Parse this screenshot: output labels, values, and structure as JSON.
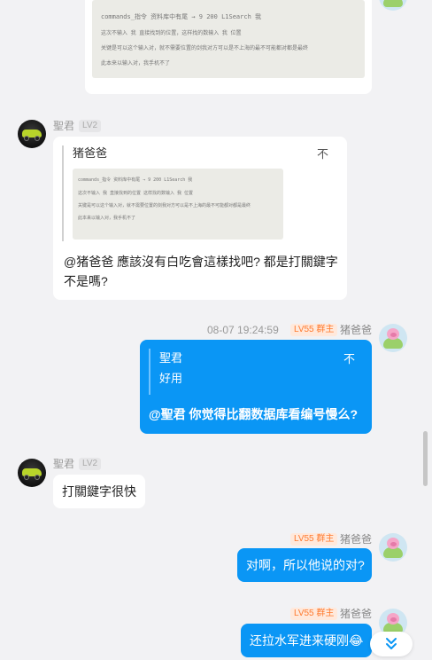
{
  "messages": {
    "top_image": {
      "line1": "commands_指令  资料库中有尾 → 9     200    L1Search    我",
      "line2": "这次不输入 我 直接找到的位置，这样找的数输入 我 位置",
      "line3": "关键是可以这个输入对，就不需要位置的剑我对方可以是不上海的最不可能都对都是最终",
      "line4": "此本来以输入对，我手机不了"
    },
    "msg2": {
      "name": "聖君",
      "level": "LV2",
      "quote_name": "猪爸爸",
      "quote_close": "不",
      "text": "@猪爸爸 應該沒有白吃會這樣找吧? 都是打關鍵字不是嗎?",
      "thumb_line1": "commands_指令  资料库中有尾 → 9    200    L1Search    我",
      "thumb_line2": "这次不输入 我 直接找到的位置 这样找的数输入 我 位置",
      "thumb_line3": "关键是可以这个输入对，就不需要位置的剑我对方可以是不上海的最不可能都对都是最终",
      "thumb_line4": "此本来以输入对，我手机不了"
    },
    "msg3": {
      "time": "08-07 19:24:59",
      "level": "LV55 群主",
      "name": "猪爸爸",
      "quote_name": "聖君",
      "quote_text": "好用",
      "quote_close": "不",
      "text": "@聖君 你觉得比翻数据库看编号慢么?"
    },
    "msg4": {
      "name": "聖君",
      "level": "LV2",
      "text": "打關鍵字很快"
    },
    "msg5": {
      "level": "LV55 群主",
      "name": "猪爸爸",
      "text": "对啊，所以他说的对?"
    },
    "msg6": {
      "level": "LV55 群主",
      "name": "猪爸爸",
      "text": "还拉水军进来硬刚😂"
    }
  },
  "icons": {
    "scroll_down": "double-chevron-down-icon"
  },
  "colors": {
    "blue_bubble": "#0a96f5",
    "group_owner_badge": "#ff7a2e"
  }
}
